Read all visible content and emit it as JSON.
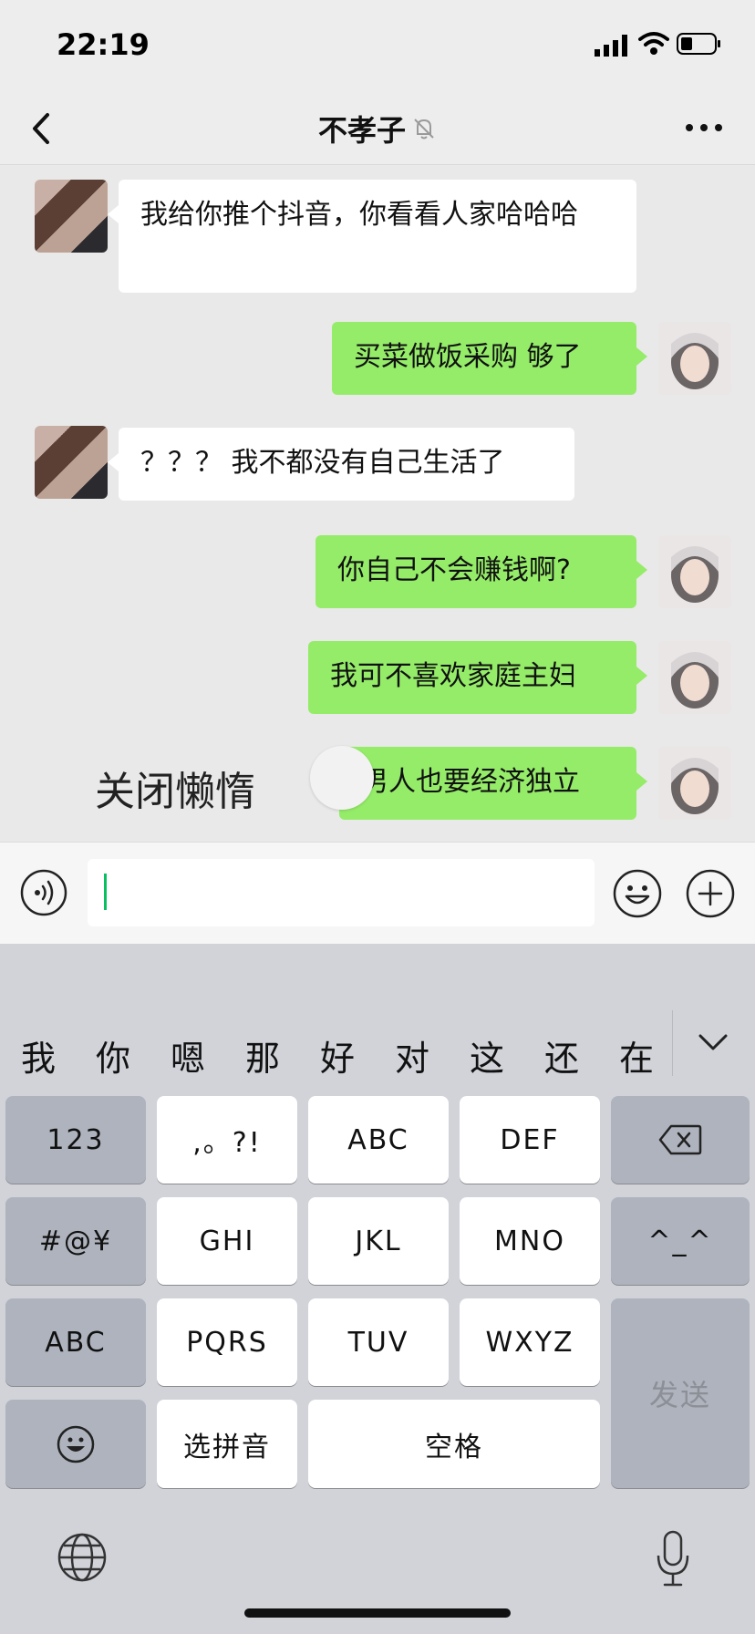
{
  "status_bar": {
    "time": "22:19"
  },
  "nav": {
    "title": "不孝子"
  },
  "messages": [
    {
      "from": "them",
      "text": "我给你推个抖音，你看看人家哈哈哈"
    },
    {
      "from": "me",
      "text": "买菜做饭采购 够了"
    },
    {
      "from": "them",
      "text": "？？？ 我不都没有自己生活了"
    },
    {
      "from": "me",
      "text": "你自己不会赚钱啊?"
    },
    {
      "from": "me",
      "text": "我可不喜欢家庭主妇"
    },
    {
      "from": "me",
      "text": "男人也要经济独立"
    }
  ],
  "overlay": {
    "lazy_label": "关闭懒惰"
  },
  "input": {
    "value": ""
  },
  "keyboard": {
    "candidates": [
      "我",
      "你",
      "嗯",
      "那",
      "好",
      "对",
      "这",
      "还",
      "在"
    ],
    "keys": {
      "num": "123",
      "punct": ",。?!",
      "abc": "ABC",
      "def": "DEF",
      "sym": "#@¥",
      "ghi": "GHI",
      "jkl": "JKL",
      "mno": "MNO",
      "face": "^_^",
      "abc_switch": "ABC",
      "pqrs": "PQRS",
      "tuv": "TUV",
      "wxyz": "WXYZ",
      "send": "发送",
      "pinyin": "选拼音",
      "space": "空格"
    }
  },
  "colors": {
    "outgoing_bubble": "#95ec69",
    "incoming_bubble": "#ffffff",
    "cursor": "#07c160"
  }
}
